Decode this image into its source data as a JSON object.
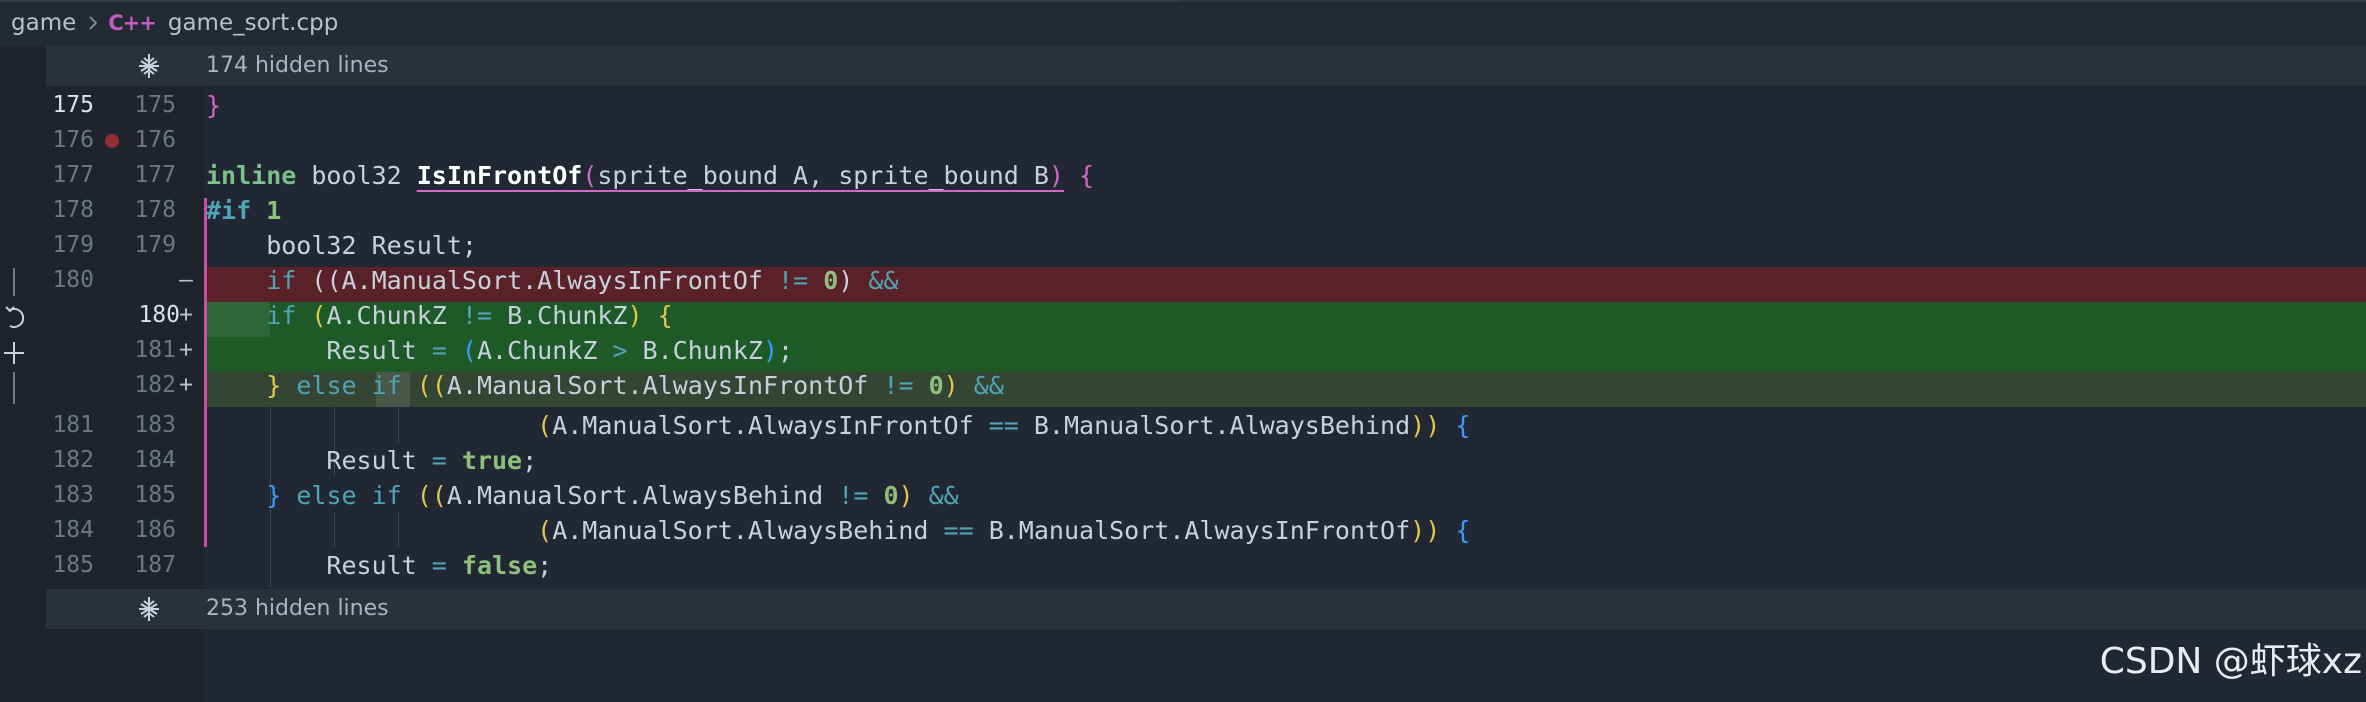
{
  "breadcrumb": {
    "folder": "game",
    "file_icon": "C++",
    "file": "game_sort.cpp"
  },
  "folds": {
    "top": "174 hidden lines",
    "bottom": "253 hidden lines"
  },
  "lines": [
    {
      "old": "175",
      "new": "175",
      "mark": ""
    },
    {
      "old": "176",
      "new": "176",
      "mark": ""
    },
    {
      "old": "177",
      "new": "177",
      "mark": ""
    },
    {
      "old": "178",
      "new": "178",
      "mark": ""
    },
    {
      "old": "179",
      "new": "179",
      "mark": ""
    },
    {
      "old": "180",
      "new": "",
      "mark": "—"
    },
    {
      "old": "",
      "new": "180",
      "mark": "+"
    },
    {
      "old": "",
      "new": "181",
      "mark": "+"
    },
    {
      "old": "",
      "new": "182",
      "mark": "+"
    },
    {
      "old": "181",
      "new": "183",
      "mark": ""
    },
    {
      "old": "182",
      "new": "184",
      "mark": ""
    },
    {
      "old": "183",
      "new": "185",
      "mark": ""
    },
    {
      "old": "184",
      "new": "186",
      "mark": ""
    },
    {
      "old": "185",
      "new": "187",
      "mark": ""
    }
  ],
  "code": {
    "l1": {
      "a": "}"
    },
    "l3": {
      "a": "inline",
      "b": " bool32 ",
      "c": "IsInFrontOf",
      "d": "(",
      "e": "sprite_bound A, sprite_bound B",
      "f": ")",
      "g": " {"
    },
    "l4": {
      "a": "#if",
      "b": " ",
      "c": "1"
    },
    "l5": {
      "a": "    bool32 Result;"
    },
    "l6": {
      "a": "    ",
      "b": "if",
      "c": " ",
      "d": "(",
      "e": "(",
      "f": "A.ManualSort.AlwaysInFrontOf ",
      "g": "!=",
      "h": " ",
      "i": "0",
      "j": ")",
      "k": " ",
      "l": "&&"
    },
    "l7": {
      "a": "    ",
      "b": "if",
      "c": " ",
      "d": "(",
      "e": "A.ChunkZ ",
      "f": "!=",
      "g": " B.ChunkZ",
      "h": ")",
      "i": " {"
    },
    "l8": {
      "a": "        Result ",
      "b": "=",
      "c": " ",
      "d": "(",
      "e": "A.ChunkZ ",
      "f": ">",
      "g": " B.ChunkZ",
      "h": ")",
      "i": ";"
    },
    "l9": {
      "a": "    ",
      "b": "}",
      "c": " ",
      "d": "else",
      "e": " ",
      "f": "if",
      "g": " ",
      "h": "(",
      "i": "(",
      "j": "A.ManualSort.AlwaysInFrontOf ",
      "k": "!=",
      "l": " ",
      "m": "0",
      "n": ")",
      "o": " ",
      "p": "&&"
    },
    "l10": {
      "a": "                      ",
      "b": "(",
      "c": "A.ManualSort.AlwaysInFrontOf ",
      "d": "==",
      "e": " B.ManualSort.AlwaysBehind",
      "f": ")",
      "g": ")",
      "h": " {"
    },
    "l11": {
      "a": "        Result ",
      "b": "=",
      "c": " ",
      "d": "true",
      "e": ";"
    },
    "l12": {
      "a": "    ",
      "b": "}",
      "c": " ",
      "d": "else",
      "e": " ",
      "f": "if",
      "g": " ",
      "h": "(",
      "i": "(",
      "j": "A.ManualSort.AlwaysBehind ",
      "k": "!=",
      "l": " ",
      "m": "0",
      "n": ")",
      "o": " ",
      "p": "&&"
    },
    "l13": {
      "a": "                      ",
      "b": "(",
      "c": "A.ManualSort.AlwaysBehind ",
      "d": "==",
      "e": " B.ManualSort.AlwaysInFrontOf",
      "f": ")",
      "g": ")",
      "h": " {"
    },
    "l14": {
      "a": "        Result ",
      "b": "=",
      "c": " ",
      "d": "false",
      "e": ";"
    }
  },
  "colors": {
    "deleted_line": "#5a2128",
    "added_line": "#1e5a27",
    "preprocessor_bar": "#c94fa9",
    "editor_background": "#222833"
  },
  "icons": [
    "chevron-right-icon",
    "cpp-file-icon",
    "unfold-icon",
    "breakpoint-icon",
    "revert-icon",
    "add-icon"
  ],
  "watermark": "CSDN @虾球xz"
}
